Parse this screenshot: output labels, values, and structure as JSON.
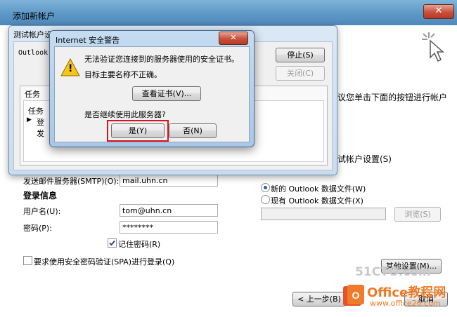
{
  "outer": {
    "title": "添加新帐户",
    "close_glyph": "✕",
    "right_text_1": "议您单击下面的按钮进行帐户",
    "right_text_2": "试帐户设置(S)",
    "outgoing_partial": "发送邮件服务器(SMTP)(O):",
    "outgoing_value": "mail.uhn.cn",
    "login_heading": "登录信息",
    "username_label": "用户名(U):",
    "username_value": "tom@uhn.cn",
    "password_label": "密码(P):",
    "password_value": "********",
    "remember_label": "记住密码(R)",
    "spa_label": "要求使用安全密码验证(SPA)进行登录(Q)",
    "new_file_label": "新的 Outlook 数据文件(W)",
    "existing_file_label": "现有 Outlook 数据文件(X)",
    "browse_label": "浏览(S)",
    "more_settings_label": "其他设置(M)...",
    "back_label": "< 上一步(B)",
    "cancel_label": "取消",
    "watermark_1": "51CTO.com",
    "watermark_2": "Office教程网",
    "watermark_3": "www.office26.com"
  },
  "test_dialog": {
    "title": "测试帐户设",
    "outlook_label": "Outlook",
    "stop_label": "停止(S)",
    "close_label": "关闭(C)",
    "tasks_tab": "任务",
    "task_col": "任务",
    "task_1": "登",
    "task_2": "发"
  },
  "alert": {
    "title": "Internet 安全警告",
    "close_glyph": "✕",
    "line1": "无法验证您连接到的服务器使用的安全证书。",
    "line2": "目标主要名称不正确。",
    "view_cert_label": "查看证书(V)...",
    "question": "是否继续使用此服务器?",
    "yes_label": "是(Y)",
    "no_label": "否(N)",
    "warning_glyph": "!"
  }
}
